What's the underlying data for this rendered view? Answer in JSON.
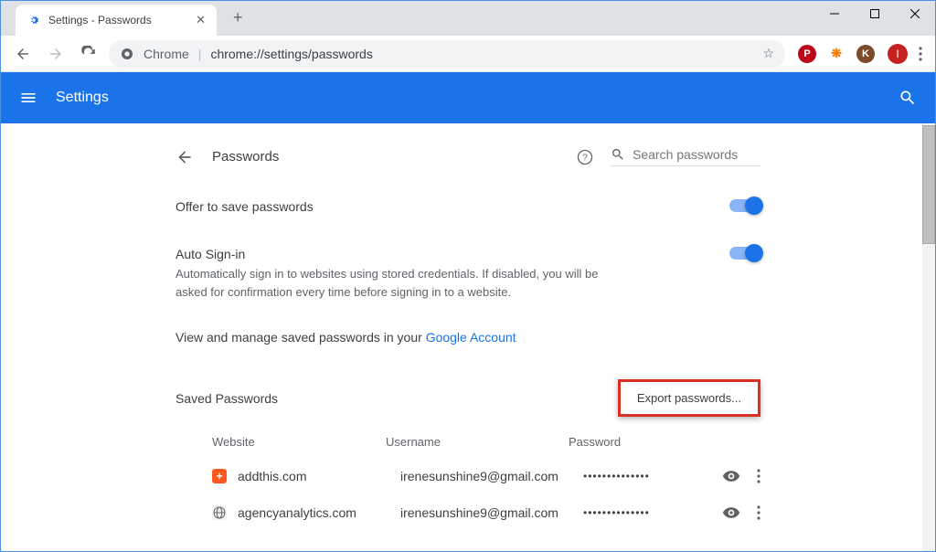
{
  "window": {
    "tab_title": "Settings - Passwords"
  },
  "toolbar": {
    "protocol_label": "Chrome",
    "url_display": "chrome://settings/passwords"
  },
  "profile": {
    "initial": "I"
  },
  "header": {
    "title": "Settings"
  },
  "page": {
    "title": "Passwords",
    "search_placeholder": "Search passwords",
    "offer_save": "Offer to save passwords",
    "auto_signin_title": "Auto Sign-in",
    "auto_signin_desc": "Automatically sign in to websites using stored credentials. If disabled, you will be asked for confirmation every time before signing in to a website.",
    "view_manage_prefix": "View and manage saved passwords in your ",
    "view_manage_link": "Google Account",
    "saved_title": "Saved Passwords",
    "export_label": "Export passwords...",
    "col_website": "Website",
    "col_username": "Username",
    "col_password": "Password",
    "rows": [
      {
        "site": "addthis.com",
        "user": "irenesunshine9@gmail.com",
        "mask": "••••••••••••••",
        "fav_bg": "#ff5722",
        "fav_text": "+",
        "fav_color": "#fff"
      },
      {
        "site": "agencyanalytics.com",
        "user": "irenesunshine9@gmail.com",
        "mask": "••••••••••••••",
        "fav_bg": "#f1f3f4",
        "fav_text": "",
        "fav_color": "#5f6368"
      }
    ]
  }
}
